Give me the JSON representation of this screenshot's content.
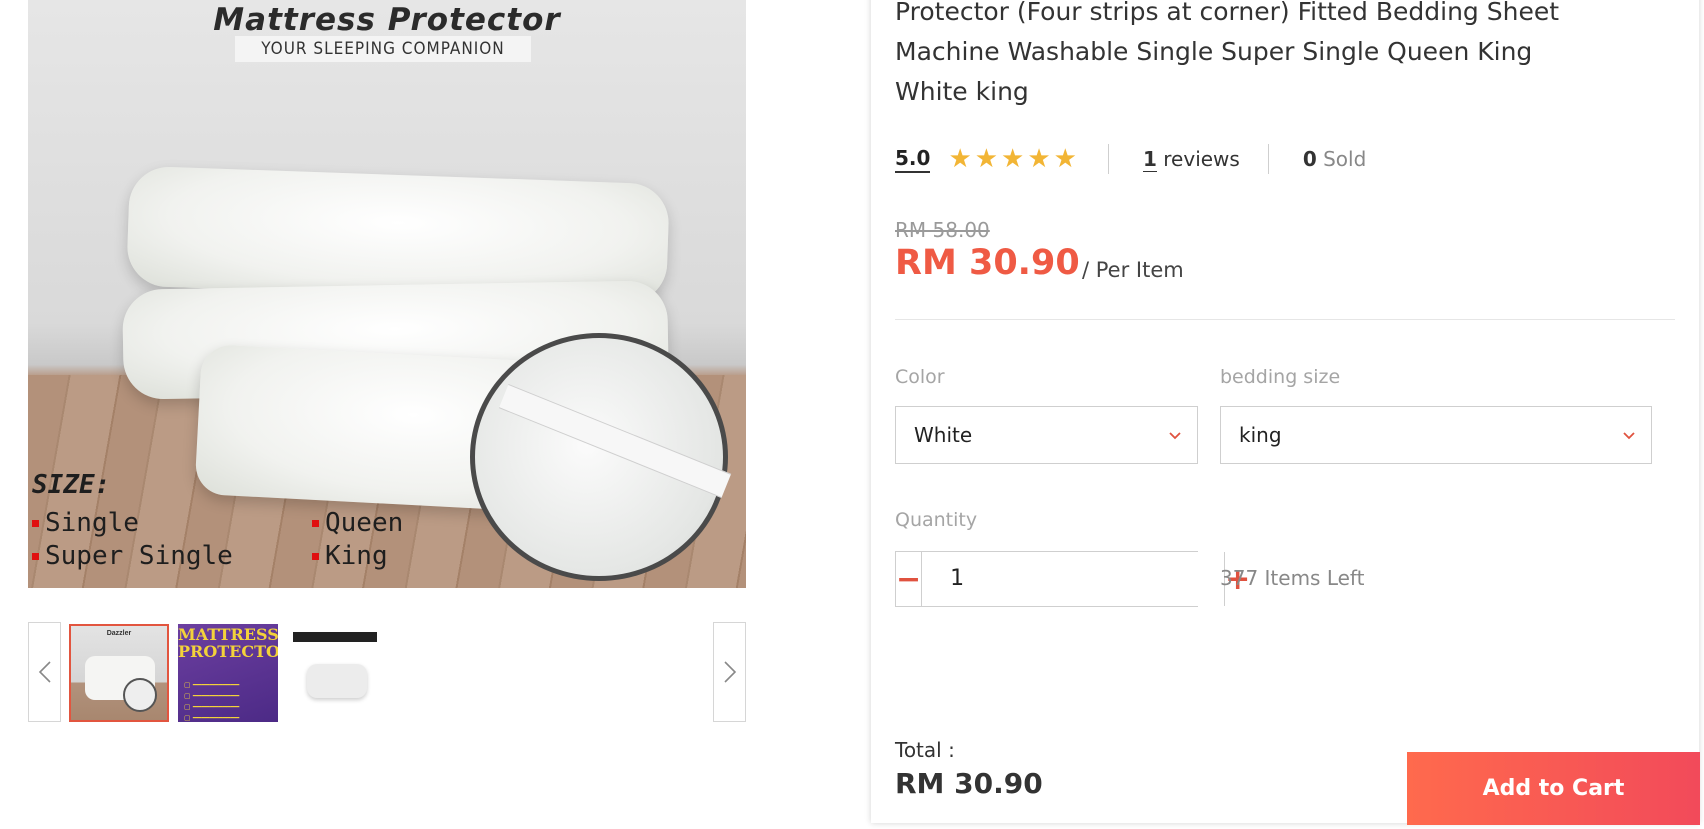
{
  "gallery": {
    "main_image": {
      "title": "Mattress Protector",
      "tagline": "YOUR SLEEPING COMPANION",
      "size_heading": "SIZE:",
      "sizes": [
        "Single",
        "Super Single",
        "Queen",
        "King"
      ]
    },
    "prev_icon": "chevron-left-icon",
    "next_icon": "chevron-right-icon",
    "thumb2_title_1": "MATTRESS",
    "thumb2_title_2": "PROTECTOR"
  },
  "product": {
    "title_lines": [
      "Protector (Four strips at corner) Fitted Bedding Sheet",
      "Machine Washable Single Super Single Queen King",
      "White king"
    ],
    "rating": "5.0",
    "stars": "★★★★★",
    "reviews_count": "1",
    "reviews_label": "reviews",
    "sold_count": "0",
    "sold_label": "Sold",
    "price_original": "RM 58.00",
    "price_current": "RM 30.90",
    "price_unit": "/ Per Item"
  },
  "options": {
    "color_label": "Color",
    "color_value": "White",
    "size_label": "bedding size",
    "size_value": "king",
    "chevron": "⌄"
  },
  "quantity": {
    "label": "Quantity",
    "value": "1",
    "minus": "−",
    "plus": "+",
    "stock": "377 Items Left"
  },
  "footer": {
    "total_label": "Total :",
    "total_value": "RM 30.90",
    "add_to_cart": "Add to Cart"
  },
  "colors": {
    "accent": "#ef5a44",
    "star": "#f2b535",
    "button_start": "#ff6a4d",
    "button_end": "#f24a5a"
  }
}
